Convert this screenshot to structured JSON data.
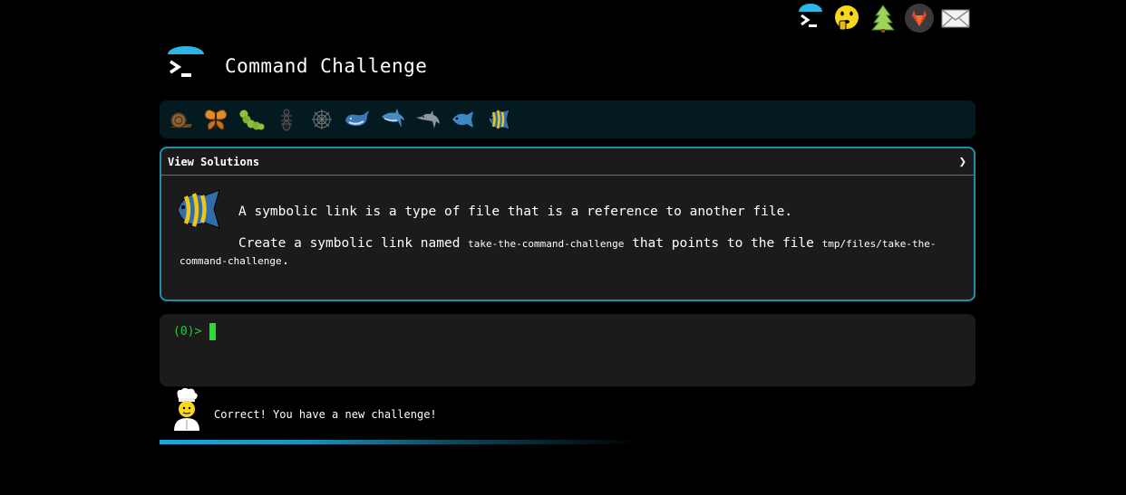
{
  "app": {
    "title": "Command Challenge"
  },
  "top_icons": [
    {
      "name": "terminal-icon"
    },
    {
      "name": "shushing-face-icon"
    },
    {
      "name": "tree-icon"
    },
    {
      "name": "gitlab-icon"
    },
    {
      "name": "envelope-icon"
    }
  ],
  "levels": [
    {
      "name": "snail-icon"
    },
    {
      "name": "butterfly-icon"
    },
    {
      "name": "caterpillar-icon"
    },
    {
      "name": "ant-icon"
    },
    {
      "name": "spider-web-icon"
    },
    {
      "name": "whale-icon"
    },
    {
      "name": "shark-icon"
    },
    {
      "name": "dolphin-icon"
    },
    {
      "name": "fish-icon"
    },
    {
      "name": "tropical-fish-icon"
    }
  ],
  "panel": {
    "header": "View Solutions",
    "chevron": "❯",
    "description": "A symbolic link is a type of file that is a reference to another file.",
    "task_prefix": "Create a symbolic link named ",
    "task_link_name": "take-the-command-challenge",
    "task_middle": " that points to the file ",
    "task_target": "tmp/files/take-the-command-challenge",
    "task_suffix": "."
  },
  "terminal": {
    "prompt": "(0)>"
  },
  "status": {
    "message": "Correct! You have a new challenge!"
  },
  "progress": {
    "fraction": 0.59
  },
  "colors": {
    "accent": "#1f8fa8",
    "prompt": "#28c940",
    "cursor": "#23e22b"
  }
}
